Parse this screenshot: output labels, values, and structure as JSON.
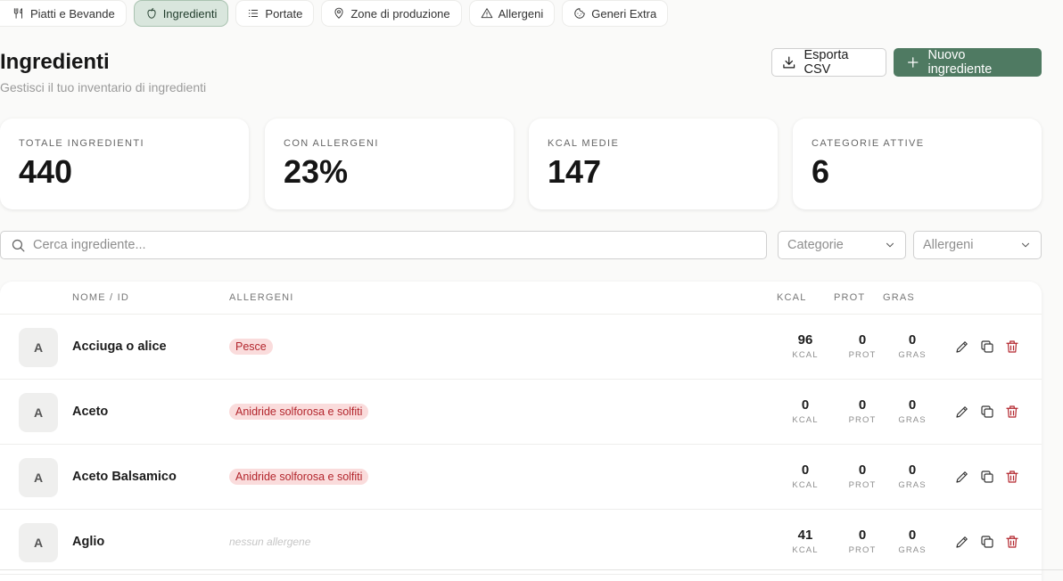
{
  "tabs": [
    {
      "label": "Piatti e Bevande",
      "icon": "utensils-icon",
      "active": false
    },
    {
      "label": "Ingredienti",
      "icon": "apple-icon",
      "active": true
    },
    {
      "label": "Portate",
      "icon": "list-icon",
      "active": false
    },
    {
      "label": "Zone di produzione",
      "icon": "map-pin-icon",
      "active": false
    },
    {
      "label": "Allergeni",
      "icon": "warning-icon",
      "active": false
    },
    {
      "label": "Generi Extra",
      "icon": "cookie-icon",
      "active": false
    }
  ],
  "header": {
    "title": "Ingredienti",
    "subtitle": "Gestisci il tuo inventario di ingredienti",
    "export_label": "Esporta CSV",
    "new_label": "Nuovo ingrediente"
  },
  "stats": [
    {
      "label": "TOTALE INGREDIENTI",
      "value": "440"
    },
    {
      "label": "CON ALLERGENI",
      "value": "23%"
    },
    {
      "label": "KCAL MEDIE",
      "value": "147"
    },
    {
      "label": "CATEGORIE ATTIVE",
      "value": "6"
    }
  ],
  "filters": {
    "search_placeholder": "Cerca ingrediente...",
    "category_placeholder": "Categorie",
    "allergen_placeholder": "Allergeni"
  },
  "table": {
    "columns": {
      "name": "NOME / ID",
      "allergens": "ALLERGENI",
      "kcal": "KCAL",
      "prot": "PROT",
      "gras": "GRAS"
    },
    "unit_labels": {
      "kcal": "KCAL",
      "prot": "PROT",
      "gras": "GRAS"
    },
    "no_allergen_text": "nessun allergene",
    "rows": [
      {
        "initial": "A",
        "name": "Acciuga o alice",
        "allergen": "Pesce",
        "kcal": "96",
        "prot": "0",
        "gras": "0"
      },
      {
        "initial": "A",
        "name": "Aceto",
        "allergen": "Anidride solforosa e solfiti",
        "kcal": "0",
        "prot": "0",
        "gras": "0"
      },
      {
        "initial": "A",
        "name": "Aceto Balsamico",
        "allergen": "Anidride solforosa e solfiti",
        "kcal": "0",
        "prot": "0",
        "gras": "0"
      },
      {
        "initial": "A",
        "name": "Aglio",
        "allergen": "",
        "kcal": "41",
        "prot": "0",
        "gras": "0"
      }
    ]
  },
  "colors": {
    "accent": "#4f7a62",
    "active_tab_bg": "#d9e6dd",
    "allergen_badge_bg": "#fadcdc",
    "allergen_badge_text": "#b3262d"
  }
}
